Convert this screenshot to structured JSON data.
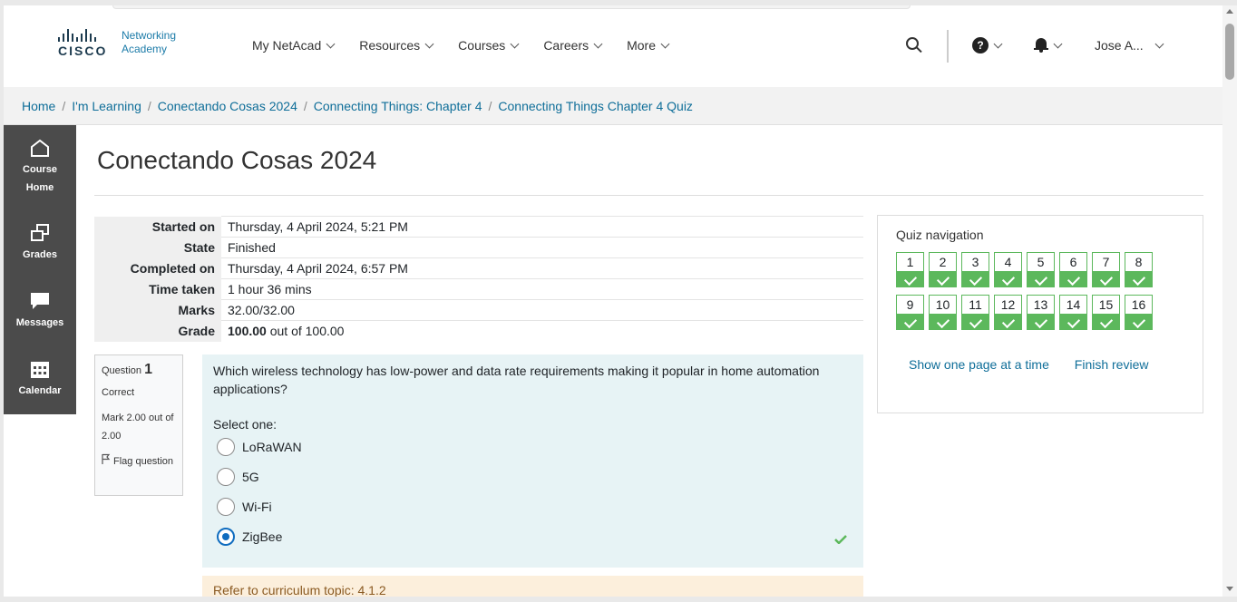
{
  "header": {
    "logo_word": "CISCO",
    "logo_line1": "Networking",
    "logo_line2": "Academy",
    "nav": [
      "My NetAcad",
      "Resources",
      "Courses",
      "Careers",
      "More"
    ],
    "help_glyph": "?",
    "user_name": "Jose A..."
  },
  "breadcrumb": [
    "Home",
    "I'm Learning",
    "Conectando Cosas 2024",
    "Connecting Things: Chapter 4",
    "Connecting Things Chapter 4 Quiz"
  ],
  "sidebar": {
    "course_home_line1": "Course",
    "course_home_line2": "Home",
    "grades": "Grades",
    "messages": "Messages",
    "calendar": "Calendar"
  },
  "page_title": "Conectando Cosas 2024",
  "summary": [
    {
      "label": "Started on",
      "value": "Thursday, 4 April 2024, 5:21 PM"
    },
    {
      "label": "State",
      "value": "Finished"
    },
    {
      "label": "Completed on",
      "value": "Thursday, 4 April 2024, 6:57 PM"
    },
    {
      "label": "Time taken",
      "value": "1 hour 36 mins"
    },
    {
      "label": "Marks",
      "value": "32.00/32.00"
    },
    {
      "label": "Grade",
      "value_bold": "100.00",
      "value_rest": " out of 100.00"
    }
  ],
  "question": {
    "label": "Question",
    "number": "1",
    "status": "Correct",
    "mark": "Mark 2.00 out of 2.00",
    "flag": "Flag question",
    "text": "Which wireless technology has low-power and data rate requirements making it popular in home automation applications?",
    "select_one": "Select one:",
    "options": [
      "LoRaWAN",
      "5G",
      "Wi-Fi",
      "ZigBee"
    ],
    "selected_index": 3,
    "feedback": "Refer to curriculum topic: 4.1.2"
  },
  "quiz_nav": {
    "title": "Quiz navigation",
    "questions": [
      "1",
      "2",
      "3",
      "4",
      "5",
      "6",
      "7",
      "8",
      "9",
      "10",
      "11",
      "12",
      "13",
      "14",
      "15",
      "16"
    ],
    "show_one_page": "Show one page at a time",
    "finish_review": "Finish review"
  },
  "colors": {
    "link": "#0f6e99",
    "sidebar": "#4b4b4b",
    "correct": "#5cb85c",
    "question_bg": "#e7f3f5",
    "feedback_bg": "#fcefdc"
  }
}
